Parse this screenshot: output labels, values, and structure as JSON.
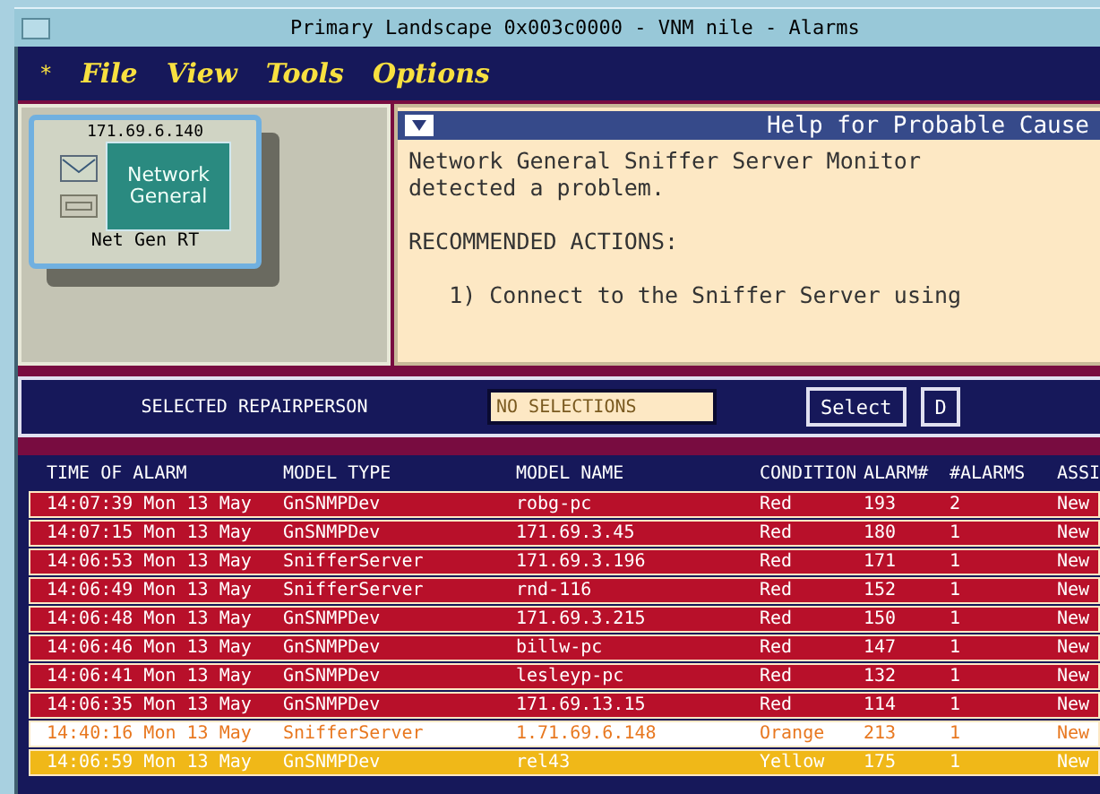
{
  "window": {
    "title": "Primary Landscape 0x003c0000 - VNM nile - Alarms"
  },
  "menu": {
    "marker": "*",
    "items": [
      "File",
      "View",
      "Tools",
      "Options"
    ]
  },
  "device": {
    "address": "171.69.6.140",
    "logo": [
      "Network",
      "General"
    ],
    "label": "Net Gen RT"
  },
  "help": {
    "title": "Help for Probable Cause",
    "paragraphs": [
      [
        "Network General Sniffer Server Monitor",
        "detected a problem."
      ],
      [
        "RECOMMENDED ACTIONS:"
      ],
      [
        "   1) Connect to the Sniffer Server using"
      ]
    ]
  },
  "repair": {
    "label": "SELECTED REPAIRPERSON",
    "value": "NO SELECTIONS",
    "buttons": [
      "Select",
      "D"
    ]
  },
  "table": {
    "columns": [
      "TIME OF ALARM",
      "MODEL TYPE",
      "MODEL NAME",
      "CONDITION",
      "ALARM#",
      "#ALARMS",
      "ASSI"
    ],
    "rows": [
      {
        "cells": [
          "14:07:39 Mon 13 May",
          "GnSNMPDev",
          "robg-pc",
          "Red",
          "193",
          "2",
          "New"
        ],
        "kind": "filled",
        "color": "#b8102a"
      },
      {
        "cells": [
          "14:07:15 Mon 13 May",
          "GnSNMPDev",
          "171.69.3.45",
          "Red",
          "180",
          "1",
          "New"
        ],
        "kind": "filled",
        "color": "#b8102a"
      },
      {
        "cells": [
          "14:06:53 Mon 13 May",
          "SnifferServer",
          "171.69.3.196",
          "Red",
          "171",
          "1",
          "New"
        ],
        "kind": "filled",
        "color": "#b8102a"
      },
      {
        "cells": [
          "14:06:49 Mon 13 May",
          "SnifferServer",
          "rnd-116",
          "Red",
          "152",
          "1",
          "New"
        ],
        "kind": "filled",
        "color": "#b8102a"
      },
      {
        "cells": [
          "14:06:48 Mon 13 May",
          "GnSNMPDev",
          "171.69.3.215",
          "Red",
          "150",
          "1",
          "New"
        ],
        "kind": "filled",
        "color": "#b8102a"
      },
      {
        "cells": [
          "14:06:46 Mon 13 May",
          "GnSNMPDev",
          "billw-pc",
          "Red",
          "147",
          "1",
          "New"
        ],
        "kind": "filled",
        "color": "#b8102a"
      },
      {
        "cells": [
          "14:06:41 Mon 13 May",
          "GnSNMPDev",
          "lesleyp-pc",
          "Red",
          "132",
          "1",
          "New"
        ],
        "kind": "filled",
        "color": "#b8102a"
      },
      {
        "cells": [
          "14:06:35 Mon 13 May",
          "GnSNMPDev",
          "171.69.13.15",
          "Red",
          "114",
          "1",
          "New"
        ],
        "kind": "filled",
        "color": "#b8102a"
      },
      {
        "cells": [
          "14:40:16 Mon 13 May",
          "SnifferServer",
          "1.71.69.6.148",
          "Orange",
          "213",
          "1",
          "New"
        ],
        "kind": "text",
        "color": "#e87820"
      },
      {
        "cells": [
          "14:06:59 Mon 13 May",
          "GnSNMPDev",
          "rel43",
          "Yellow",
          "175",
          "1",
          "New"
        ],
        "kind": "filled",
        "color": "#f0b818"
      }
    ]
  }
}
